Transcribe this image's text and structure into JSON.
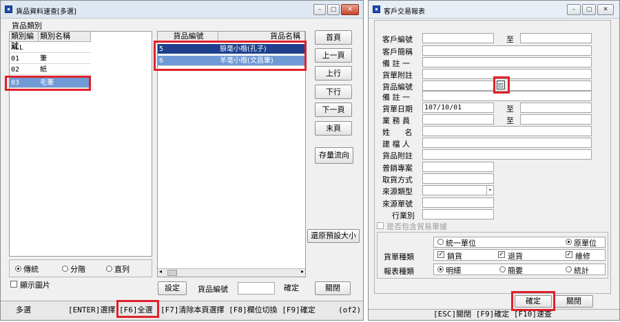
{
  "left": {
    "title": "貨品資料速查[多選]",
    "category_label": "貨品類別",
    "cat_headers": [
      "類別編號",
      "類別名稱"
    ],
    "cat_rows": [
      {
        "code": "ALL",
        "name": ""
      },
      {
        "code": "01",
        "name": "筆"
      },
      {
        "code": "02",
        "name": "紙"
      },
      {
        "code": "03",
        "name": "毛筆"
      }
    ],
    "prod_headers": [
      "貨品編號",
      "貨品名稱"
    ],
    "prod_rows": [
      {
        "code": "5",
        "name": "狼毫小楷(孔子)"
      },
      {
        "code": "6",
        "name": "羊毫小楷(文昌筆)"
      }
    ],
    "nav_buttons": [
      "首頁",
      "上一頁",
      "上行",
      "下行",
      "下一頁",
      "末頁"
    ],
    "stock_button": "存量流向",
    "restore_button": "還原預設大小",
    "radios": [
      "傳統",
      "分階",
      "直列"
    ],
    "show_image": "顯示圖片",
    "settings_button": "設定",
    "product_code_label": "貨品編號",
    "confirm_button": "確定",
    "close_button": "關閉",
    "status_mode": "多選",
    "status_enter": "[ENTER]選擇",
    "status_f6": "[F6]全選",
    "status_rest": "[F7]清除本頁選擇 [F8]欄位切換 [F9]確定",
    "status_page": "(of2)"
  },
  "right": {
    "title": "客戶交易報表",
    "fields": {
      "customer_no": "客戶編號",
      "to": "至",
      "customer_short": "客戶簡稱",
      "note1": "備 註 一",
      "bill_note": "貨單附註",
      "product_no": "貨品編號",
      "note1b": "備 註 一",
      "bill_date": "貨單日期",
      "bill_date_value": "107/10/01",
      "salesman": "業 務 員",
      "name": "姓 名",
      "creator": "建 檔 人",
      "product_note": "貨品附註",
      "promo": "普銷專案",
      "pickup": "取貨方式",
      "source_type": "來源類型",
      "source_no": "來源單號",
      "industry": "行業別"
    },
    "include_trade": "是否包含貿易單據",
    "unit_unified": "統一單位",
    "unit_original": "原單位",
    "bill_type_label": "貨單種類",
    "bill_types": [
      "銷貨",
      "退貨",
      "維修"
    ],
    "report_type_label": "報表種類",
    "report_types": [
      "明細",
      "簡要",
      "統計"
    ],
    "confirm_button": "確定",
    "close_button": "關閉",
    "status": "[ESC]關閉 [F9]確定 [F10]速查"
  }
}
